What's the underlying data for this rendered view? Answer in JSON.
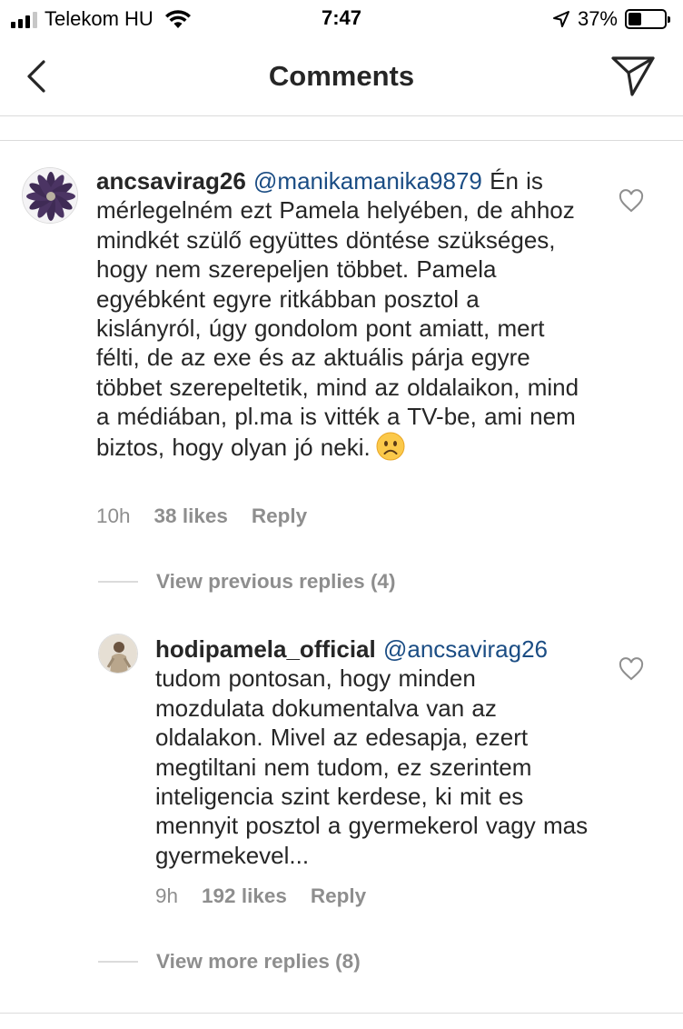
{
  "status_bar": {
    "carrier": "Telekom HU",
    "time": "7:47",
    "battery": "37%",
    "battery_level": 0.37,
    "icons": [
      "signal-icon",
      "wifi-icon",
      "location-arrow-icon",
      "battery-icon"
    ]
  },
  "nav": {
    "title": "Comments",
    "icons": [
      "back-chevron-icon",
      "direct-send-icon"
    ]
  },
  "comments": [
    {
      "username": "ancsavirag26",
      "mention": "@manikamanika9879",
      "text": " Én is mérlegelném ezt Pamela helyében, de ahhoz mindkét szülő együttes döntése szükséges, hogy nem szerepeljen többet. Pamela egyébként egyre ritkábban posztol a kislányról, úgy gondolom pont amiatt, mert félti, de az exe és az aktuális párja egyre többet szerepeltetik, mind az oldalaikon, mind a médiában, pl.ma is vitték a TV-be, ami nem biztos, hogy olyan jó neki.",
      "emoji": "☹",
      "time": "10h",
      "likes": "38 likes",
      "reply": "Reply"
    },
    {
      "username": "hodipamela_official",
      "mention": "@ancsavirag26",
      "text": " tudom pontosan, hogy minden mozdulata dokumentalva van az oldalakon. Mivel az edesapja, ezert megtiltani nem tudom, ez szerintem inteligencia szint kerdese, ki mit es mennyit posztol a gyermekerol vagy mas gyermekevel...",
      "time": "9h",
      "likes": "192 likes",
      "reply": "Reply"
    }
  ],
  "view_previous_replies": "View previous replies (4)",
  "view_more_replies": "View more replies (8)",
  "colors": {
    "text": "#262626",
    "secondary": "#8e8e8e",
    "mention": "#1b4d84",
    "divider": "#dbdbdb"
  }
}
